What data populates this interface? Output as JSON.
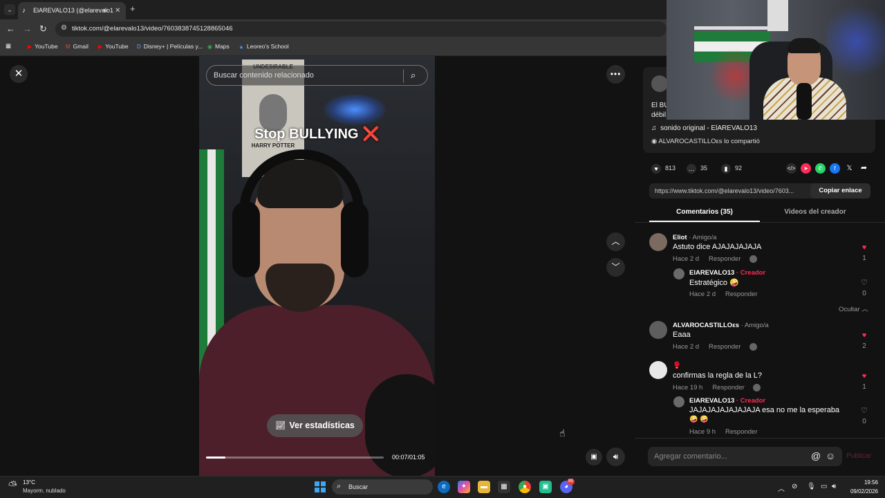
{
  "browser": {
    "tab_title": "ElAREVALO13 (@elarevalo1",
    "tab_favicon": "tiktok-icon",
    "url": "tiktok.com/@elarevalo13/video/7603838745128865046",
    "bookmarks": [
      "YouTube",
      "Gmail",
      "YouTube",
      "Disney+ | Películas y...",
      "Maps",
      "Leoreo's School"
    ]
  },
  "video": {
    "overlay_text": "Stop BULLYING",
    "overlay_emoji": "❌",
    "search_placeholder": "Buscar contenido relacionado",
    "stats_button": "Ver estadísticas",
    "timecode": "00:07/01:05",
    "progress": 0.11
  },
  "post": {
    "description_1": "El BU",
    "description_2": "débil",
    "music": "sonido original - ElAREVALO13",
    "shared_by": "ALVAROCASTILLOεs lo compartió",
    "likes": "813",
    "comments": "35",
    "saves": "92",
    "link": "https://www.tiktok.com/@elarevalo13/video/7603...",
    "copy_label": "Copiar enlace"
  },
  "tabs": {
    "comments": "Comentarios (35)",
    "creator_videos": "Videos del creador"
  },
  "comments": [
    {
      "name": "Eliot",
      "tag": " · Amigo/a",
      "text": "Astuto dice AJAJAJAJAJA",
      "time": "Hace 2 d",
      "reply": "Responder",
      "likes": "1",
      "liked": true
    },
    {
      "name": "ElAREVALO13",
      "tag": " · Creador",
      "text": "Estratégico 🤪",
      "time": "Hace 2 d",
      "reply": "Responder",
      "likes": "0",
      "liked": false
    },
    {
      "name": "ALVAROCASTILLOεs",
      "tag": " · Amigo/a",
      "text": "Eaaa",
      "time": "Hace 2 d",
      "reply": "Responder",
      "likes": "2",
      "liked": true
    },
    {
      "name": "🥊",
      "tag": "",
      "text": "confirmas la regla de la L?",
      "time": "Hace 19 h",
      "reply": "Responder",
      "likes": "1",
      "liked": true
    },
    {
      "name": "ElAREVALO13",
      "tag": " · Creador",
      "text": "JAJAJAJAJAJAJAJA esa no me la esperaba",
      "text2": "🤪 🤪",
      "time": "Hace 9 h",
      "reply": "Responder",
      "likes": "0",
      "liked": false
    }
  ],
  "hide_replies": "Ocultar",
  "add_comment": {
    "placeholder": "Agregar comentario...",
    "publish": "Publicar"
  },
  "taskbar": {
    "temp": "13°C",
    "weather": "Mayorm. nublado",
    "search": "Buscar",
    "time": "19:56",
    "date": "09/02/2026",
    "discord_badge": "99"
  },
  "colors": {
    "accent": "#fe2c55",
    "background": "#121212"
  }
}
